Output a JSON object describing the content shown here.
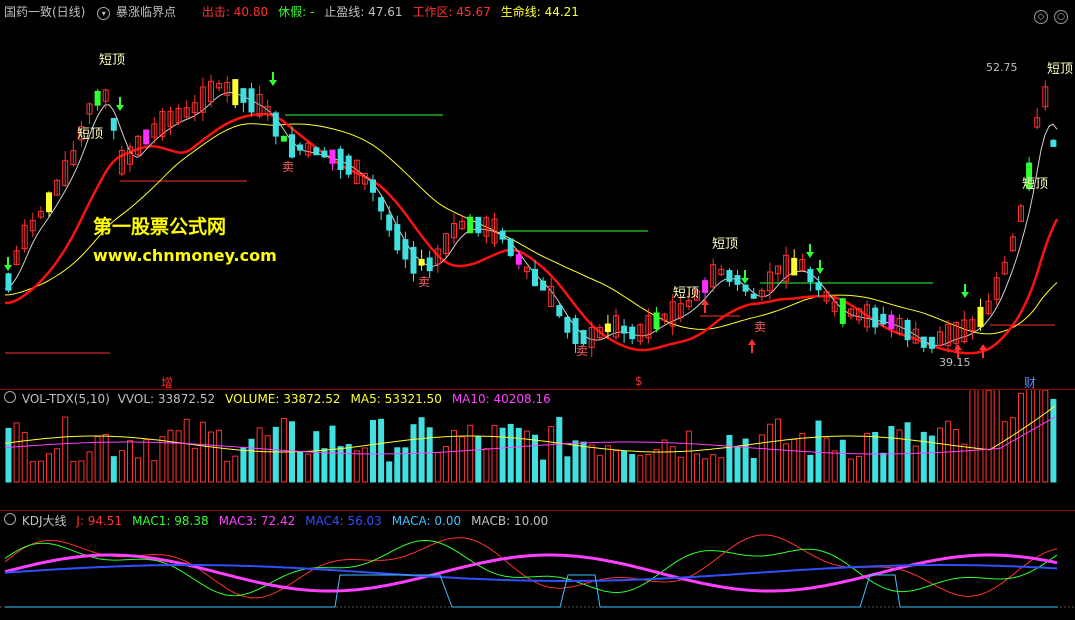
{
  "main_header": {
    "title": "国药一致(日线)",
    "indicator": "暴涨临界点",
    "items": [
      {
        "label": "出击:",
        "value": "40.80",
        "color": "#ff3030"
      },
      {
        "label": "休假:",
        "value": "-",
        "color": "#30ff30"
      },
      {
        "label": "止盈线:",
        "value": "47.61",
        "color": "#c0c0c0"
      },
      {
        "label": "工作区:",
        "value": "45.67",
        "color": "#ff3030"
      },
      {
        "label": "生命线:",
        "value": "44.21",
        "color": "#ffff30"
      }
    ]
  },
  "watermark": {
    "line1": "第一股票公式网",
    "line2": "www.chnmoney.com"
  },
  "annotations": {
    "short_top": "短顶",
    "sell": "卖",
    "high_price": "52.75",
    "low_price": "39.15",
    "bottom_marks": [
      "增",
      "$",
      "财"
    ]
  },
  "vol_header": {
    "name": "VOL-TDX(5,10)",
    "items": [
      {
        "label": "VVOL:",
        "value": "33872.52",
        "color": "#c0c0c0"
      },
      {
        "label": "VOLUME:",
        "value": "33872.52",
        "color": "#ffff30"
      },
      {
        "label": "MA5:",
        "value": "53321.50",
        "color": "#ffff30"
      },
      {
        "label": "MA10:",
        "value": "40208.16",
        "color": "#ff40ff"
      }
    ]
  },
  "kdj_header": {
    "name": "KDJ大线",
    "items": [
      {
        "label": "J:",
        "value": "94.51",
        "color": "#ff3030"
      },
      {
        "label": "MAC1:",
        "value": "98.38",
        "color": "#30ff30"
      },
      {
        "label": "MAC3:",
        "value": "72.42",
        "color": "#ff40ff"
      },
      {
        "label": "MAC4:",
        "value": "56.03",
        "color": "#3050ff"
      },
      {
        "label": "MACA:",
        "value": "0.00",
        "color": "#40c0ff"
      },
      {
        "label": "MACB:",
        "value": "10.00",
        "color": "#c0c0c0"
      }
    ]
  },
  "colors": {
    "up": "#ff3030",
    "down": "#40e0e0",
    "ma_fast": "#ffffff",
    "ma_slow": "#ffff30",
    "ma_red": "#ff1010"
  }
}
